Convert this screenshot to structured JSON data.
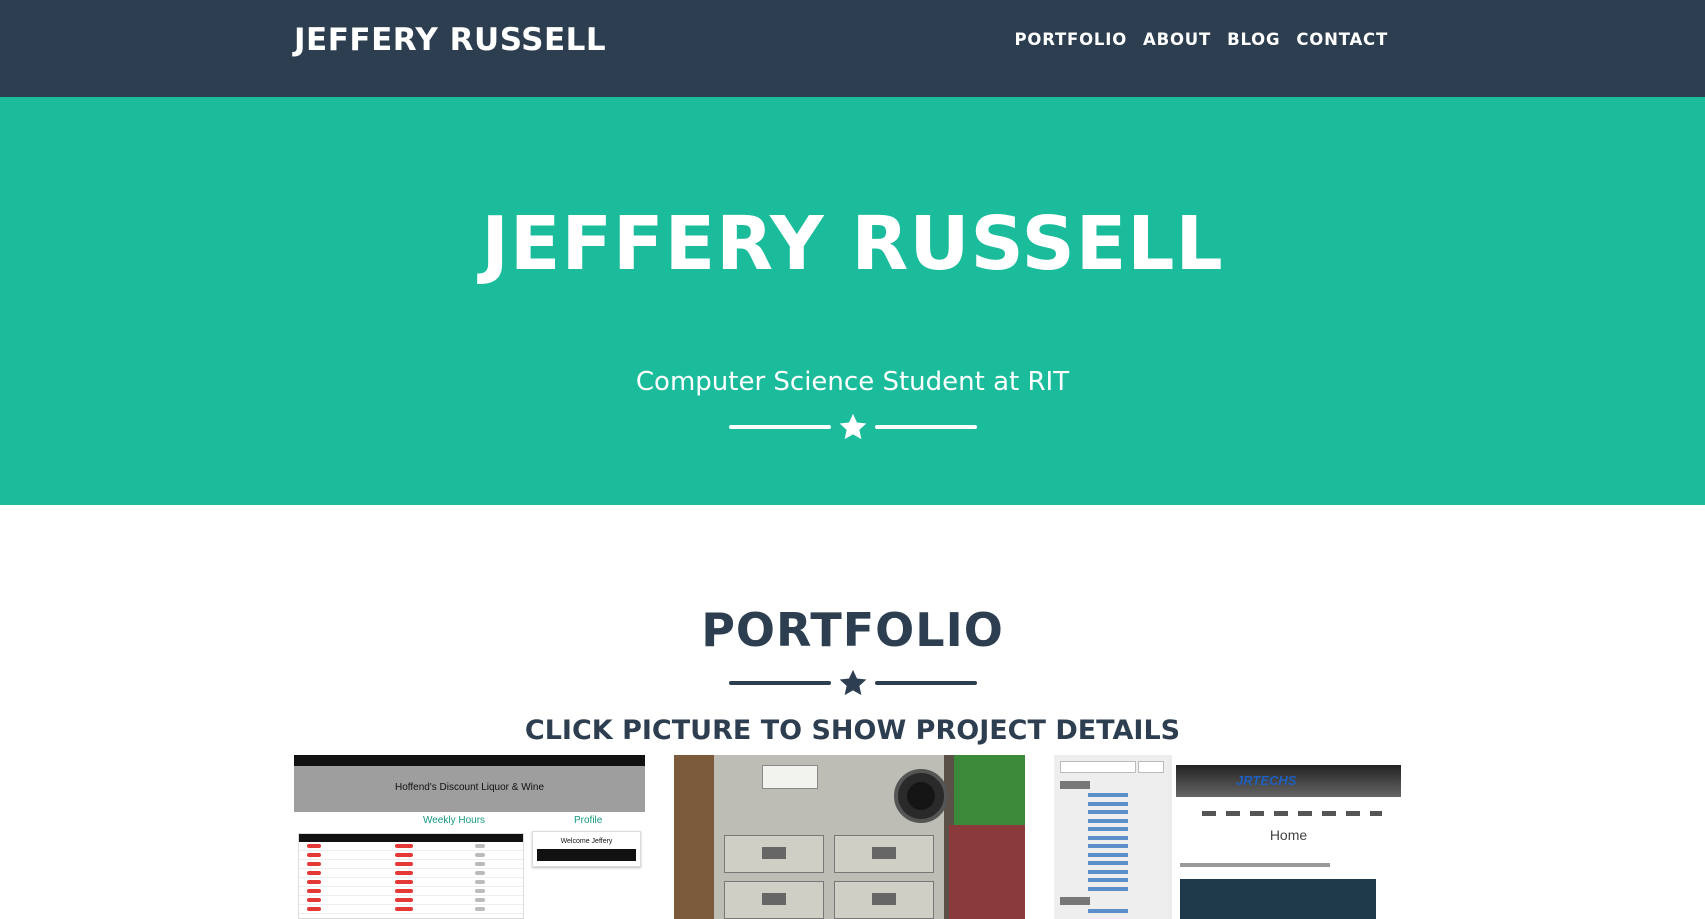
{
  "navbar": {
    "brand": "JEFFERY RUSSELL",
    "links": [
      "PORTFOLIO",
      "ABOUT",
      "BLOG",
      "CONTACT"
    ]
  },
  "hero": {
    "title": "JEFFERY RUSSELL",
    "subtitle": "Computer Science Student at RIT"
  },
  "portfolio": {
    "title": "PORTFOLIO",
    "hint": "CLICK PICTURE TO SHOW PROJECT DETAILS",
    "cards": [
      {
        "banner": "Hoffend's Discount Liquor & Wine",
        "weekly_hours": "Weekly Hours",
        "profile": "Profile",
        "welcome": "Welcome Jeffery"
      },
      {},
      {
        "logo": "JRTECHS",
        "page_heading": "Home"
      }
    ]
  },
  "colors": {
    "navbar": "#2c3e50",
    "hero": "#1abc9c",
    "text_dark": "#2c3e50",
    "white": "#ffffff"
  },
  "icons": {
    "hero_divider": "star-icon",
    "portfolio_divider": "star-icon"
  }
}
